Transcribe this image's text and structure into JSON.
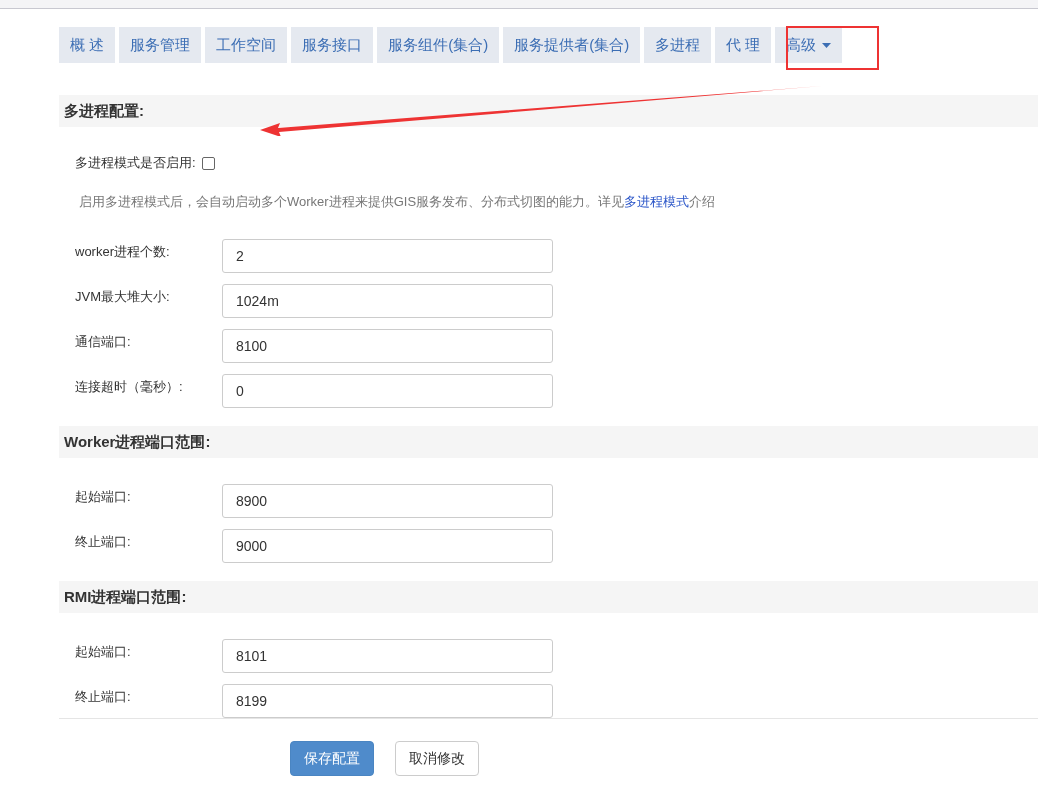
{
  "tabs": [
    {
      "label": "概 述",
      "selected": false
    },
    {
      "label": "服务管理",
      "selected": false
    },
    {
      "label": "工作空间",
      "selected": false
    },
    {
      "label": "服务接口",
      "selected": false
    },
    {
      "label": "服务组件(集合)",
      "selected": false
    },
    {
      "label": "服务提供者(集合)",
      "selected": false
    },
    {
      "label": "多进程",
      "selected": false
    },
    {
      "label": "代 理",
      "selected": false
    },
    {
      "label": "高级",
      "selected": false,
      "dropdown": true
    }
  ],
  "sections": [
    {
      "title": "多进程配置:",
      "enable": {
        "label": "多进程模式是否启用:",
        "checked": false
      },
      "description": {
        "before": "启用多进程模式后，会自动启动多个Worker进程来提供GIS服务发布、分布式切图的能力。详见",
        "link": "多进程模式",
        "after": "介绍"
      },
      "fields": [
        {
          "label": "worker进程个数:",
          "value": "2"
        },
        {
          "label": "JVM最大堆大小:",
          "value": "1024m"
        },
        {
          "label": "通信端口:",
          "value": "8100"
        },
        {
          "label": "连接超时（毫秒）:",
          "value": "0"
        }
      ]
    },
    {
      "title": "Worker进程端口范围:",
      "fields": [
        {
          "label": "起始端口:",
          "value": "8900"
        },
        {
          "label": "终止端口:",
          "value": "9000"
        }
      ]
    },
    {
      "title": "RMI进程端口范围:",
      "fields": [
        {
          "label": "起始端口:",
          "value": "8101"
        },
        {
          "label": "终止端口:",
          "value": "8199"
        }
      ]
    }
  ],
  "buttons": [
    {
      "label": "保存配置",
      "kind": "primary"
    },
    {
      "label": "取消修改",
      "kind": "default"
    }
  ]
}
